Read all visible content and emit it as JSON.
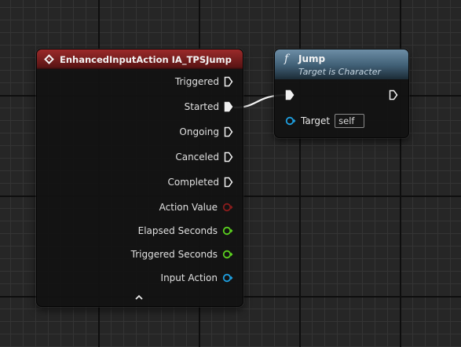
{
  "event_node": {
    "title": "EnhancedInputAction IA_TPSJump",
    "exec_outputs": [
      "Triggered",
      "Started",
      "Ongoing",
      "Canceled",
      "Completed"
    ],
    "data_outputs": [
      {
        "label": "Action Value",
        "color": "#8b1c1c"
      },
      {
        "label": "Elapsed Seconds",
        "color": "#5bd11f"
      },
      {
        "label": "Triggered Seconds",
        "color": "#5bd11f"
      },
      {
        "label": "Input Action",
        "color": "#1e9fe0"
      }
    ],
    "header_color": "#8a2424"
  },
  "jump_node": {
    "icon": "f",
    "title": "Jump",
    "subtitle": "Target is Character",
    "target_label": "Target",
    "target_value": "self",
    "header_color": "#56778e",
    "target_pin_color": "#1e9fe0"
  },
  "icons": {
    "event_icon": "diamond-icon",
    "function_icon": "function-icon",
    "collapse": "chevron-up-icon"
  }
}
